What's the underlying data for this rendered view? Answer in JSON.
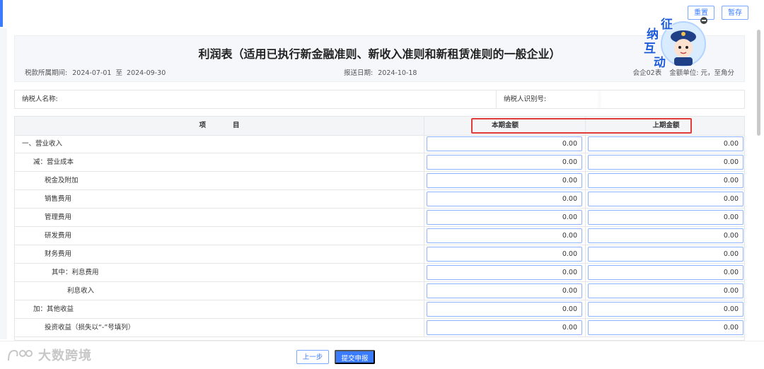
{
  "toolbar": {
    "reset_label": "重置",
    "save_draft_label": "暂存"
  },
  "report": {
    "title": "利润表（适用已执行新金融准则、新收入准则和新租赁准则的一般企业）",
    "period_label": "税款所属期间:",
    "period_start": "2024-07-01",
    "period_to": "至",
    "period_end": "2024-09-30",
    "report_date_label": "报送日期:",
    "report_date": "2024-10-18",
    "form_code": "会企02表",
    "unit_label": "金额单位:",
    "unit_value": "元，至角分"
  },
  "taxpayer": {
    "name_label": "纳税人名称:",
    "name_value": "",
    "id_label": "纳税人识别号:",
    "id_value": ""
  },
  "table": {
    "header_item": "项目",
    "header_current": "本期金额",
    "header_previous": "上期金额",
    "rows": [
      {
        "label": "一、营业收入",
        "current": "0.00",
        "previous": "0.00"
      },
      {
        "label": "减：营业成本",
        "current": "0.00",
        "previous": "0.00"
      },
      {
        "label": "税金及附加",
        "current": "0.00",
        "previous": "0.00"
      },
      {
        "label": "销售费用",
        "current": "0.00",
        "previous": "0.00"
      },
      {
        "label": "管理费用",
        "current": "0.00",
        "previous": "0.00"
      },
      {
        "label": "研发费用",
        "current": "0.00",
        "previous": "0.00"
      },
      {
        "label": "财务费用",
        "current": "0.00",
        "previous": "0.00"
      },
      {
        "label": "其中：利息费用",
        "current": "0.00",
        "previous": "0.00"
      },
      {
        "label": "利息收入",
        "current": "0.00",
        "previous": "0.00"
      },
      {
        "label": "加：其他收益",
        "current": "0.00",
        "previous": "0.00"
      },
      {
        "label": "投资收益（损失以“-”号填列）",
        "current": "0.00",
        "previous": "0.00"
      }
    ]
  },
  "footer": {
    "prev_label": "上一步",
    "submit_label": "提交申报"
  },
  "mascot": {
    "chars": [
      "征",
      "纳",
      "互",
      "动"
    ]
  },
  "watermark": {
    "text": "大数跨境"
  },
  "colors": {
    "accent": "#3b7cff",
    "highlight": "#e23b3b"
  }
}
